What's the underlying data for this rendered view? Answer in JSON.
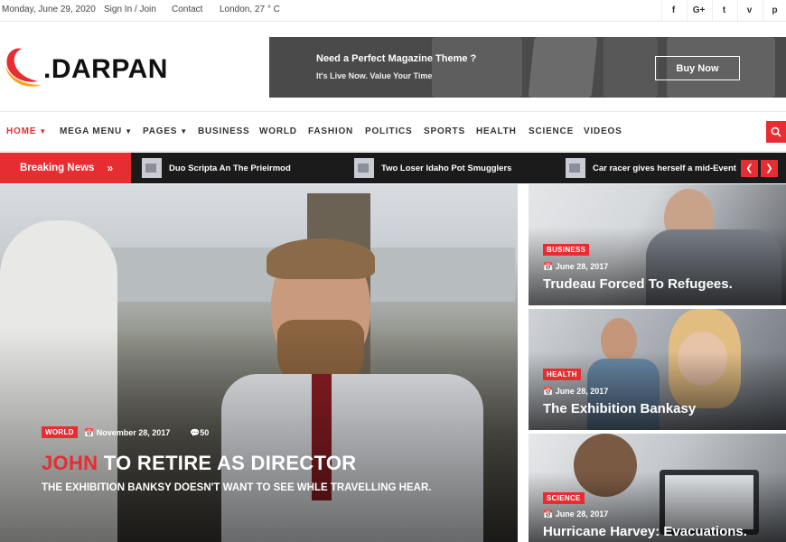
{
  "topbar": {
    "date": "Monday, June 29, 2020",
    "signin": "Sign In / Join",
    "contact": "Contact",
    "weather": "London, 27 ° C",
    "social": [
      {
        "icon": "facebook-icon",
        "glyph": "f"
      },
      {
        "icon": "google-plus-icon",
        "glyph": "G+"
      },
      {
        "icon": "twitter-icon",
        "glyph": "t"
      },
      {
        "icon": "vimeo-icon",
        "glyph": "v"
      },
      {
        "icon": "pinterest-icon",
        "glyph": "p"
      }
    ]
  },
  "logo": {
    "text": ".DARPAN",
    "accent": "#e62d32"
  },
  "banner": {
    "title": "Need a Perfect Magazine Theme ?",
    "subtitle": "It's Live Now. Value Your Time",
    "button": "Buy Now"
  },
  "nav": {
    "items": [
      {
        "label": "HOME",
        "dropdown": true,
        "active": true
      },
      {
        "label": "MEGA MENU",
        "dropdown": true
      },
      {
        "label": "PAGES",
        "dropdown": true
      },
      {
        "label": "BUSINESS"
      },
      {
        "label": "WORLD"
      },
      {
        "label": "FASHION"
      },
      {
        "label": "POLITICS"
      },
      {
        "label": "SPORTS"
      },
      {
        "label": "HEALTH"
      },
      {
        "label": "SCIENCE"
      },
      {
        "label": "VIDEOS"
      }
    ],
    "search_icon": "search-icon"
  },
  "breaking": {
    "label": "Breaking News",
    "items": [
      "Duo Scripta An The Prieirmod",
      "Two Loser Idaho Pot Smugglers",
      "Car racer gives herself a mid-Event"
    ]
  },
  "hero": {
    "category": "WORLD",
    "date": "November 28, 2017",
    "comments": "50",
    "title_highlight": "JOHN",
    "title_rest": " TO RETIRE AS DIRECTOR",
    "subtitle": "THE EXHIBITION BANKSY DOESN'T WANT TO SEE WHLE TRAVELLING HEAR."
  },
  "cards": [
    {
      "category": "BUSINESS",
      "date": "June 28, 2017",
      "title": "Trudeau Forced To Refugees."
    },
    {
      "category": "HEALTH",
      "date": "June 28, 2017",
      "title": "The Exhibition Bankasy"
    },
    {
      "category": "SCIENCE",
      "date": "June 28, 2017",
      "title": "Hurricane Harvey: Evacuations."
    }
  ],
  "colors": {
    "accent": "#e62d32",
    "dark_bar": "#1b1b1b"
  }
}
